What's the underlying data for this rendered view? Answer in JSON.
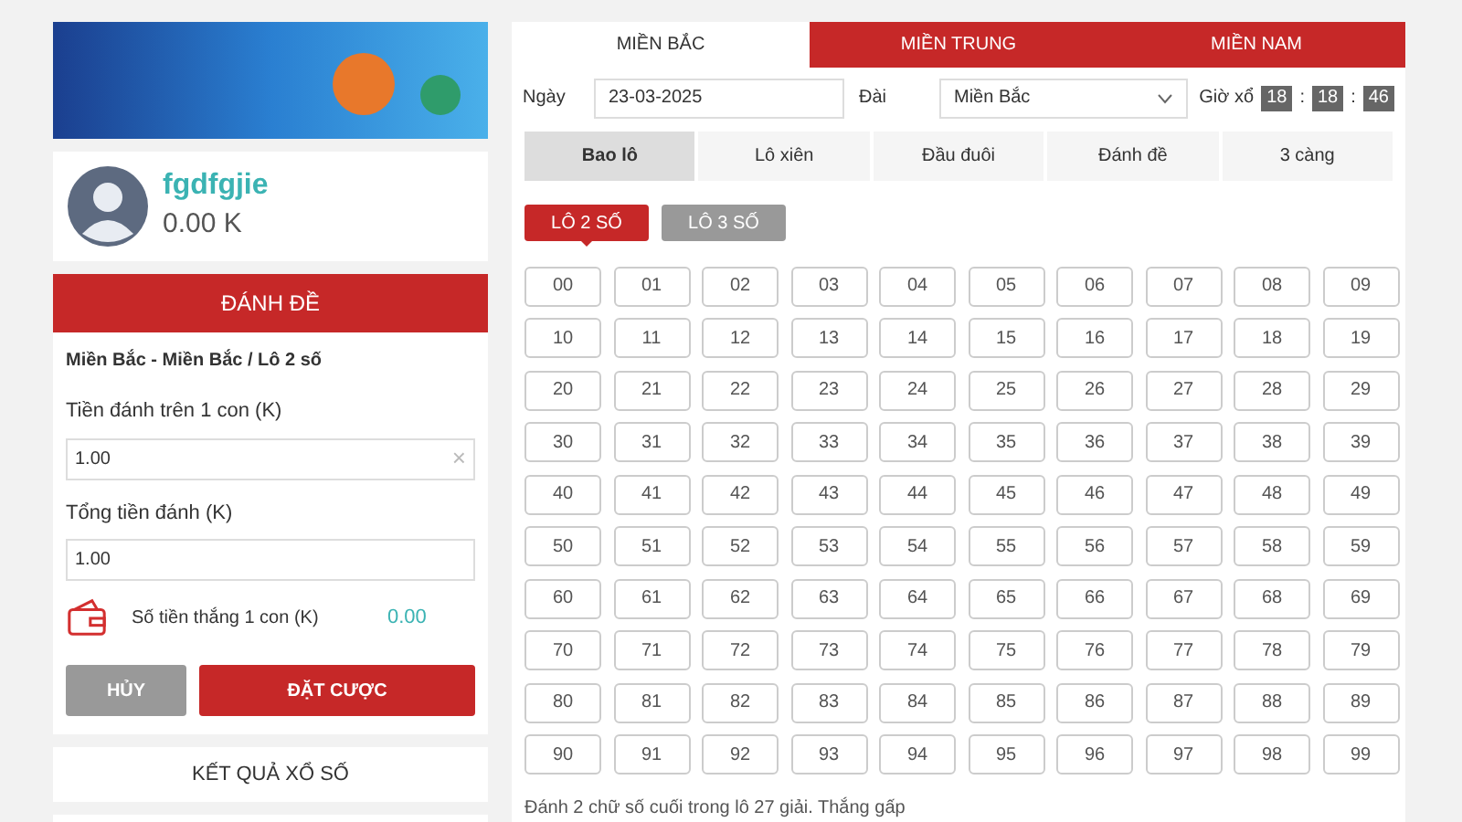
{
  "user": {
    "name": "fgdfgjie",
    "balance": "0.00 K"
  },
  "bet_panel": {
    "title": "ĐÁNH ĐỀ",
    "breadcrumb": "Miền Bắc - Miền Bắc / Lô 2 số",
    "stake_label": "Tiền đánh trên 1 con (K)",
    "stake_value": "1.00",
    "clear": "×",
    "total_label": "Tổng tiền đánh (K)",
    "total_value": "1.00",
    "win_label": "Số tiền thắng 1 con (K)",
    "win_value": "0.00",
    "cancel": "HỦY",
    "submit": "ĐẶT CƯỢC"
  },
  "sidebar_links": [
    "KẾT QUẢ XỔ SỐ"
  ],
  "region_tabs": [
    {
      "label": "MIỀN BẮC",
      "selected": true
    },
    {
      "label": "MIỀN TRUNG",
      "selected": false
    },
    {
      "label": "MIỀN NAM",
      "selected": false
    }
  ],
  "filters": {
    "date_label": "Ngày",
    "date_value": "23-03-2025",
    "station_label": "Đài",
    "station_value": "Miền Bắc",
    "draw_label": "Giờ xổ",
    "clock": [
      {
        "kind": "digit",
        "text": "18"
      },
      {
        "kind": "sep",
        "text": ":"
      },
      {
        "kind": "digit",
        "text": "18"
      },
      {
        "kind": "sep",
        "text": ":"
      },
      {
        "kind": "digit",
        "text": "46"
      }
    ]
  },
  "bet_types": [
    {
      "label": "Bao lô",
      "selected": true
    },
    {
      "label": "Lô xiên",
      "selected": false
    },
    {
      "label": "Đầu đuôi",
      "selected": false
    },
    {
      "label": "Đánh đề",
      "selected": false
    },
    {
      "label": "3 càng",
      "selected": false
    }
  ],
  "sub_types": [
    {
      "label": "LÔ 2 SỐ",
      "selected": true
    },
    {
      "label": "LÔ 3 SỐ",
      "selected": false
    }
  ],
  "numbers": [
    "00",
    "01",
    "02",
    "03",
    "04",
    "05",
    "06",
    "07",
    "08",
    "09",
    "10",
    "11",
    "12",
    "13",
    "14",
    "15",
    "16",
    "17",
    "18",
    "19",
    "20",
    "21",
    "22",
    "23",
    "24",
    "25",
    "26",
    "27",
    "28",
    "29",
    "30",
    "31",
    "32",
    "33",
    "34",
    "35",
    "36",
    "37",
    "38",
    "39",
    "40",
    "41",
    "42",
    "43",
    "44",
    "45",
    "46",
    "47",
    "48",
    "49",
    "50",
    "51",
    "52",
    "53",
    "54",
    "55",
    "56",
    "57",
    "58",
    "59",
    "60",
    "61",
    "62",
    "63",
    "64",
    "65",
    "66",
    "67",
    "68",
    "69",
    "70",
    "71",
    "72",
    "73",
    "74",
    "75",
    "76",
    "77",
    "78",
    "79",
    "80",
    "81",
    "82",
    "83",
    "84",
    "85",
    "86",
    "87",
    "88",
    "89",
    "90",
    "91",
    "92",
    "93",
    "94",
    "95",
    "96",
    "97",
    "98",
    "99"
  ],
  "description": [
    "Đánh 2 chữ số cuối trong lô 27 giải. Thắng gấp"
  ]
}
